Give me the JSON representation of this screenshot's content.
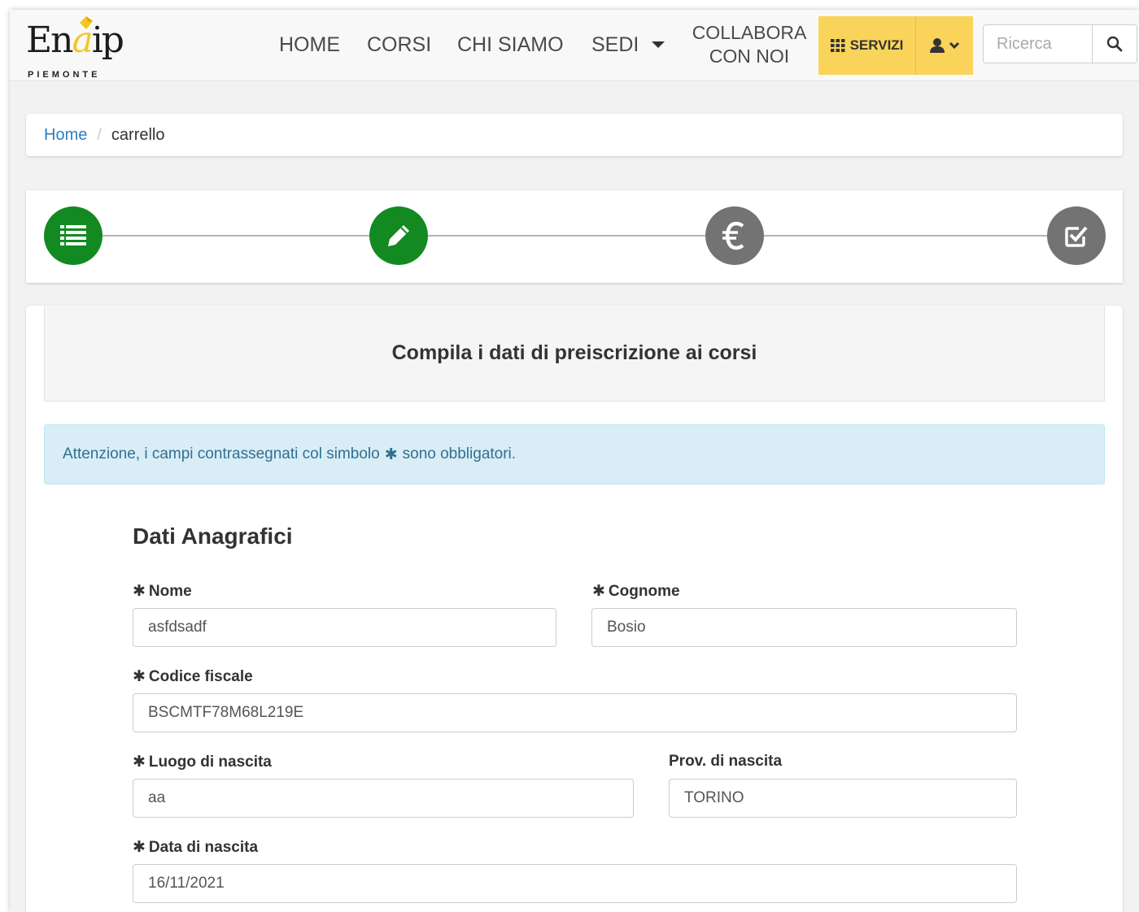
{
  "brand": {
    "name_left": "En",
    "name_accent": "a",
    "name_right": "ip",
    "subtitle": "PIEMONTE",
    "accent_color": "#f3c623"
  },
  "nav": {
    "home": "HOME",
    "corsi": "CORSI",
    "chi_siamo": "CHI SIAMO",
    "sedi": "SEDI",
    "collabora_line1": "COLLABORA",
    "collabora_line2": "CON NOI",
    "servizi": "SERVIZI",
    "user_icon": "user-icon",
    "search_placeholder": "Ricerca",
    "search_icon": "search-icon"
  },
  "breadcrumb": {
    "home": "Home",
    "separator": "/",
    "current": "carrello"
  },
  "steps": [
    {
      "icon": "list-icon",
      "status": "done"
    },
    {
      "icon": "pencil-icon",
      "status": "done"
    },
    {
      "icon": "euro-icon",
      "status": "todo"
    },
    {
      "icon": "check-square-icon",
      "status": "todo"
    }
  ],
  "colors": {
    "step_done": "#128a21",
    "step_todo": "#737373",
    "servizi_bg": "#fad45a",
    "alert_bg": "#d9edf7",
    "alert_text": "#31708f",
    "link": "#2a7ec6"
  },
  "form": {
    "title": "Compila i dati di preiscrizione ai corsi",
    "alert_before": "Attenzione, i campi contrassegnati col simbolo",
    "alert_symbol": "✱",
    "alert_after": "sono obbligatori.",
    "section_title": "Dati Anagrafici",
    "required_symbol": "✱",
    "fields": {
      "nome": {
        "label": "Nome",
        "value": "asfdsadf"
      },
      "cognome": {
        "label": "Cognome",
        "value": "Bosio"
      },
      "codice_fiscale": {
        "label": "Codice fiscale",
        "value": "BSCMTF78M68L219E"
      },
      "luogo_nascita": {
        "label": "Luogo di nascita",
        "value": "aa"
      },
      "prov_nascita": {
        "label": "Prov. di nascita",
        "value": "TORINO"
      },
      "data_nascita": {
        "label": "Data di nascita",
        "value": "16/11/2021"
      }
    }
  }
}
